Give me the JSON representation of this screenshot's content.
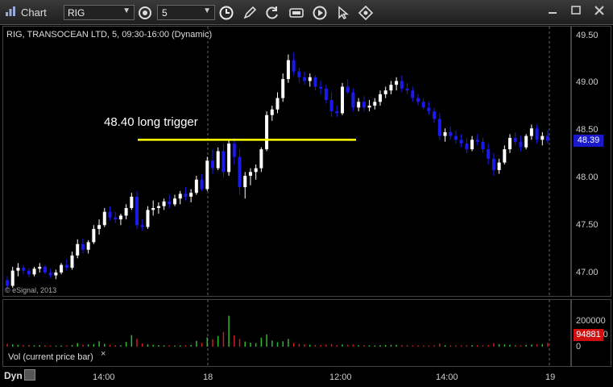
{
  "window": {
    "title": "Chart"
  },
  "toolbar": {
    "symbol": "RIG",
    "interval": "5",
    "tools": [
      "settings-icon",
      "clock-icon",
      "pencil-icon",
      "refresh-icon",
      "data-icon",
      "play-icon",
      "cursor-icon",
      "crosshair-icon"
    ]
  },
  "chart": {
    "title": "RIG, TRANSOCEAN LTD, 5, 09:30-16:00 (Dynamic)",
    "copyright": "© eSignal, 2013",
    "annotation": "48.40 long trigger",
    "current_price": "48.39"
  },
  "volume_panel": {
    "title": "Vol (current price bar)",
    "close": "×",
    "current_volume": "94881"
  },
  "footer": {
    "dyn": "Dyn"
  },
  "chart_data": {
    "type": "candlestick",
    "price_axis": {
      "labels": [
        "49.50",
        "49.00",
        "48.50",
        "48.00",
        "47.50",
        "47.00"
      ],
      "ylim": [
        46.9,
        49.6
      ]
    },
    "volume_axis": {
      "labels": [
        "200000",
        "100000",
        "0"
      ],
      "ylim": [
        0,
        300000
      ]
    },
    "x_labels": [
      "14:00",
      "18",
      "12:00",
      "14:00",
      "19"
    ],
    "trigger_line": 48.4,
    "colors": {
      "up": "#ffffff",
      "down": "#1a1aee",
      "trigger": "#ffff00",
      "vol_up": "#2db82d",
      "vol_down": "#c81e1e"
    },
    "candles": [
      [
        46.92,
        46.96,
        46.82,
        46.86
      ],
      [
        46.86,
        47.06,
        46.84,
        47.02
      ],
      [
        47.02,
        47.1,
        46.96,
        47.05
      ],
      [
        47.05,
        47.08,
        46.98,
        47.02
      ],
      [
        47.02,
        47.05,
        46.95,
        46.98
      ],
      [
        46.98,
        47.06,
        46.96,
        47.04
      ],
      [
        47.04,
        47.1,
        47.0,
        47.06
      ],
      [
        47.06,
        47.08,
        46.98,
        47.0
      ],
      [
        47.0,
        47.04,
        46.94,
        46.97
      ],
      [
        46.97,
        47.03,
        46.93,
        47.0
      ],
      [
        47.0,
        47.1,
        46.98,
        47.08
      ],
      [
        47.08,
        47.14,
        47.02,
        47.05
      ],
      [
        47.05,
        47.22,
        47.03,
        47.18
      ],
      [
        47.18,
        47.35,
        47.15,
        47.3
      ],
      [
        47.3,
        47.36,
        47.2,
        47.24
      ],
      [
        47.24,
        47.34,
        47.2,
        47.32
      ],
      [
        47.32,
        47.5,
        47.3,
        47.46
      ],
      [
        47.46,
        47.56,
        47.4,
        47.5
      ],
      [
        47.5,
        47.68,
        47.48,
        47.64
      ],
      [
        47.64,
        47.7,
        47.55,
        47.58
      ],
      [
        47.58,
        47.64,
        47.52,
        47.56
      ],
      [
        47.56,
        47.62,
        47.5,
        47.6
      ],
      [
        47.6,
        47.72,
        47.56,
        47.68
      ],
      [
        47.68,
        47.84,
        47.66,
        47.8
      ],
      [
        47.8,
        47.86,
        47.46,
        47.5
      ],
      [
        47.5,
        47.56,
        47.44,
        47.48
      ],
      [
        47.48,
        47.7,
        47.46,
        47.66
      ],
      [
        47.66,
        47.76,
        47.6,
        47.68
      ],
      [
        47.68,
        47.74,
        47.62,
        47.7
      ],
      [
        47.7,
        47.78,
        47.66,
        47.75
      ],
      [
        47.75,
        47.82,
        47.68,
        47.72
      ],
      [
        47.72,
        47.82,
        47.7,
        47.78
      ],
      [
        47.78,
        47.86,
        47.72,
        47.83
      ],
      [
        47.83,
        47.9,
        47.76,
        47.8
      ],
      [
        47.8,
        47.88,
        47.74,
        47.84
      ],
      [
        47.84,
        48.02,
        47.82,
        47.98
      ],
      [
        47.98,
        48.04,
        47.86,
        47.88
      ],
      [
        47.88,
        48.22,
        47.86,
        48.18
      ],
      [
        48.18,
        48.3,
        48.04,
        48.1
      ],
      [
        48.1,
        48.32,
        48.08,
        48.28
      ],
      [
        48.28,
        48.36,
        48.0,
        48.06
      ],
      [
        48.06,
        48.4,
        48.02,
        48.36
      ],
      [
        48.36,
        48.42,
        48.14,
        48.22
      ],
      [
        48.22,
        48.3,
        47.82,
        47.9
      ],
      [
        47.9,
        48.06,
        47.78,
        48.02
      ],
      [
        48.02,
        48.1,
        47.92,
        48.06
      ],
      [
        48.06,
        48.14,
        47.98,
        48.1
      ],
      [
        48.1,
        48.32,
        48.06,
        48.3
      ],
      [
        48.3,
        48.7,
        48.28,
        48.66
      ],
      [
        48.66,
        48.76,
        48.6,
        48.72
      ],
      [
        48.72,
        48.9,
        48.68,
        48.84
      ],
      [
        48.84,
        49.1,
        48.8,
        49.04
      ],
      [
        49.04,
        49.3,
        49.0,
        49.24
      ],
      [
        49.24,
        49.32,
        49.08,
        49.12
      ],
      [
        49.12,
        49.16,
        49.0,
        49.06
      ],
      [
        49.06,
        49.12,
        48.98,
        49.02
      ],
      [
        49.02,
        49.1,
        48.96,
        49.06
      ],
      [
        49.06,
        49.08,
        48.92,
        48.96
      ],
      [
        48.96,
        49.02,
        48.88,
        48.94
      ],
      [
        48.94,
        48.98,
        48.78,
        48.82
      ],
      [
        48.82,
        48.9,
        48.64,
        48.7
      ],
      [
        48.7,
        48.76,
        48.64,
        48.68
      ],
      [
        48.68,
        49.0,
        48.66,
        48.96
      ],
      [
        48.96,
        49.04,
        48.88,
        48.9
      ],
      [
        48.9,
        48.94,
        48.7,
        48.74
      ],
      [
        48.74,
        48.84,
        48.7,
        48.8
      ],
      [
        48.8,
        48.86,
        48.7,
        48.74
      ],
      [
        48.74,
        48.82,
        48.7,
        48.76
      ],
      [
        48.76,
        48.84,
        48.72,
        48.8
      ],
      [
        48.8,
        48.92,
        48.76,
        48.88
      ],
      [
        48.88,
        48.96,
        48.84,
        48.92
      ],
      [
        48.92,
        49.02,
        48.88,
        48.98
      ],
      [
        48.98,
        49.06,
        48.92,
        49.02
      ],
      [
        49.02,
        49.08,
        48.9,
        48.94
      ],
      [
        48.94,
        49.0,
        48.88,
        48.92
      ],
      [
        48.92,
        48.96,
        48.8,
        48.84
      ],
      [
        48.84,
        48.88,
        48.76,
        48.8
      ],
      [
        48.8,
        48.84,
        48.72,
        48.74
      ],
      [
        48.74,
        48.8,
        48.66,
        48.7
      ],
      [
        48.7,
        48.74,
        48.58,
        48.62
      ],
      [
        48.62,
        48.68,
        48.4,
        48.44
      ],
      [
        48.44,
        48.52,
        48.38,
        48.48
      ],
      [
        48.48,
        48.54,
        48.4,
        48.44
      ],
      [
        48.44,
        48.5,
        48.36,
        48.4
      ],
      [
        48.4,
        48.46,
        48.32,
        48.36
      ],
      [
        48.36,
        48.42,
        48.26,
        48.3
      ],
      [
        48.3,
        48.44,
        48.28,
        48.4
      ],
      [
        48.4,
        48.46,
        48.34,
        48.38
      ],
      [
        48.38,
        48.42,
        48.26,
        48.3
      ],
      [
        48.3,
        48.36,
        48.14,
        48.2
      ],
      [
        48.2,
        48.26,
        48.02,
        48.08
      ],
      [
        48.08,
        48.2,
        48.04,
        48.16
      ],
      [
        48.16,
        48.34,
        48.14,
        48.3
      ],
      [
        48.3,
        48.46,
        48.26,
        48.42
      ],
      [
        48.42,
        48.48,
        48.34,
        48.38
      ],
      [
        48.38,
        48.44,
        48.28,
        48.32
      ],
      [
        48.32,
        48.46,
        48.3,
        48.44
      ],
      [
        48.44,
        48.56,
        48.4,
        48.52
      ],
      [
        48.52,
        48.56,
        48.36,
        48.4
      ],
      [
        48.4,
        48.48,
        48.34,
        48.44
      ],
      [
        48.44,
        48.5,
        48.36,
        48.39
      ]
    ],
    "volumes": [
      22000,
      18000,
      15000,
      12000,
      14000,
      10000,
      12000,
      11000,
      9000,
      8000,
      9000,
      10000,
      14000,
      28000,
      16000,
      18000,
      20000,
      42000,
      22000,
      15000,
      12000,
      11000,
      38000,
      90000,
      60000,
      25000,
      18000,
      14000,
      12000,
      10000,
      11000,
      9000,
      10000,
      12000,
      14000,
      45000,
      30000,
      72000,
      58000,
      82000,
      115000,
      240000,
      88000,
      60000,
      40000,
      32000,
      28000,
      70000,
      95000,
      48000,
      35000,
      42000,
      60000,
      30000,
      22000,
      18000,
      15000,
      14000,
      13000,
      16000,
      20000,
      12000,
      18000,
      14000,
      16000,
      11000,
      12000,
      10000,
      10000,
      12000,
      13000,
      15000,
      14000,
      12000,
      11000,
      10000,
      10000,
      9000,
      9000,
      11000,
      24000,
      12000,
      10000,
      9000,
      9000,
      10000,
      12000,
      11000,
      10000,
      12000,
      28000,
      20000,
      18000,
      16000,
      12000,
      10000,
      14000,
      16000,
      18000,
      20000,
      30000
    ]
  }
}
